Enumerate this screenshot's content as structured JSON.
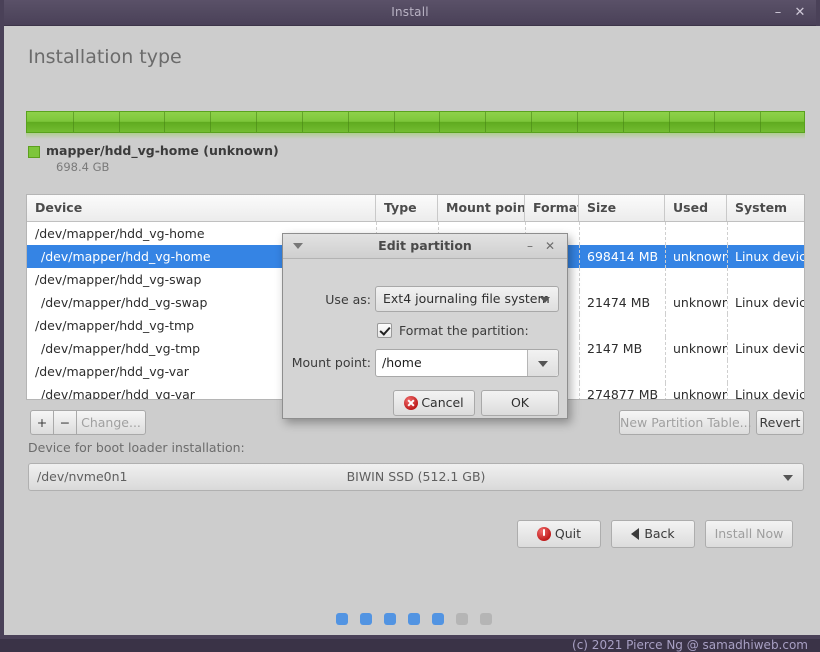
{
  "window": {
    "title": "Install",
    "minimize_icon": "minimize-icon",
    "close_icon": "close-icon",
    "minimize_glyph": "–",
    "close_glyph": "✕"
  },
  "page": {
    "title": "Installation type"
  },
  "partition_bar": {
    "segments": 17,
    "color": "#7dc63b",
    "legend": {
      "name": "mapper/hdd_vg-home",
      "status": "(unknown)",
      "size": "698.4 GB",
      "swatch_color": "#7dc63b"
    }
  },
  "table": {
    "columns": [
      "Device",
      "Type",
      "Mount point",
      "Format?",
      "Size",
      "Used",
      "System"
    ],
    "rows": [
      {
        "device": "/dev/mapper/hdd_vg-home",
        "indent": false,
        "type": "",
        "mount_point": "",
        "format": "",
        "size": "",
        "used": "",
        "system": "",
        "selected": false
      },
      {
        "device": "/dev/mapper/hdd_vg-home",
        "indent": true,
        "type": "",
        "mount_point": "",
        "format": "",
        "size": "698414 MB",
        "used": "unknown",
        "system": "Linux device-ma",
        "selected": true
      },
      {
        "device": "/dev/mapper/hdd_vg-swap",
        "indent": false,
        "type": "",
        "mount_point": "",
        "format": "",
        "size": "",
        "used": "",
        "system": "",
        "selected": false
      },
      {
        "device": "/dev/mapper/hdd_vg-swap",
        "indent": true,
        "type": "",
        "mount_point": "",
        "format": "",
        "size": "21474 MB",
        "used": "unknown",
        "system": "Linux device-ma",
        "selected": false
      },
      {
        "device": "/dev/mapper/hdd_vg-tmp",
        "indent": false,
        "type": "",
        "mount_point": "",
        "format": "",
        "size": "",
        "used": "",
        "system": "",
        "selected": false
      },
      {
        "device": "/dev/mapper/hdd_vg-tmp",
        "indent": true,
        "type": "",
        "mount_point": "",
        "format": "",
        "size": "2147 MB",
        "used": "unknown",
        "system": "Linux device-ma",
        "selected": false
      },
      {
        "device": "/dev/mapper/hdd_vg-var",
        "indent": false,
        "type": "",
        "mount_point": "",
        "format": "",
        "size": "",
        "used": "",
        "system": "",
        "selected": false
      },
      {
        "device": "/dev/mapper/hdd_vg-var",
        "indent": true,
        "type": "",
        "mount_point": "",
        "format": "",
        "size": "274877 MB",
        "used": "unknown",
        "system": "Linux device-ma",
        "selected": false
      }
    ]
  },
  "toolbar": {
    "add_label": "+",
    "remove_label": "−",
    "change_label": "Change...",
    "new_partition_table_label": "New Partition Table...",
    "revert_label": "Revert"
  },
  "bootloader": {
    "label": "Device for boot loader installation:",
    "device": "/dev/nvme0n1",
    "description": "BIWIN SSD (512.1 GB)"
  },
  "nav": {
    "quit_label": "Quit",
    "back_label": "Back",
    "install_label": "Install Now"
  },
  "progress": {
    "total_steps": 7,
    "completed_steps": 5
  },
  "watermark": "(c) 2021 Pierce Ng @ samadhiweb.com",
  "dialog": {
    "title": "Edit partition",
    "minimize_glyph": "–",
    "close_glyph": "✕",
    "use_as_label": "Use as:",
    "use_as_value": "Ext4 journaling file system",
    "format_label": "Format the partition:",
    "format_checked": true,
    "mount_point_label": "Mount point:",
    "mount_point_value": "/home",
    "cancel_label": "Cancel",
    "ok_label": "OK"
  }
}
